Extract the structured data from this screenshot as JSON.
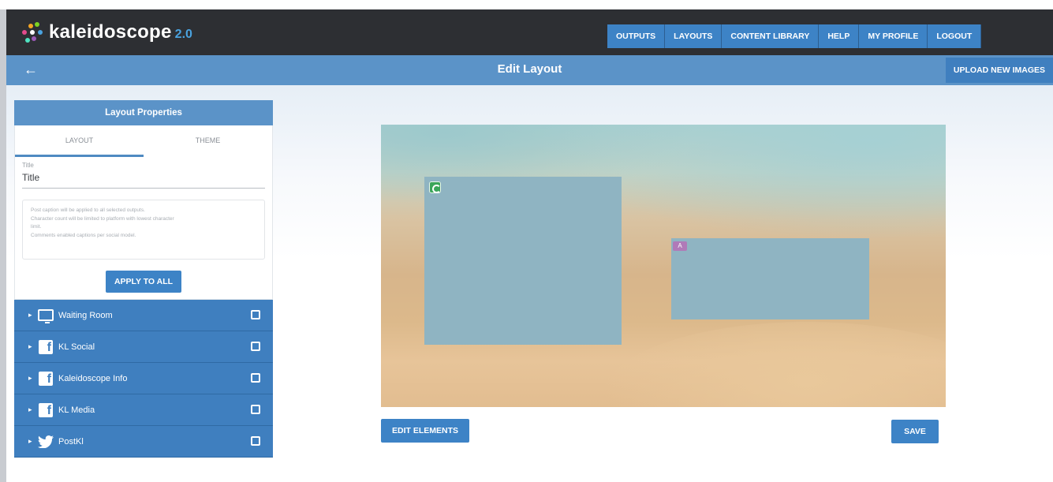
{
  "app": {
    "name": "kaleidoscope",
    "version": "2.0"
  },
  "nav": {
    "items": [
      "OUTPUTS",
      "LAYOUTS",
      "CONTENT LIBRARY",
      "HELP",
      "MY PROFILE",
      "LOGOUT"
    ]
  },
  "titlebar": {
    "back_icon": "back-arrow-icon",
    "title": "Edit Layout",
    "upload_label": "UPLOAD NEW IMAGES"
  },
  "panel": {
    "heading": "Layout Properties",
    "tabs": [
      "LAYOUT",
      "THEME"
    ],
    "active_tab": "LAYOUT",
    "title_field": {
      "label": "Title",
      "value": "Title"
    },
    "notes": [
      "Post caption will be applied to all selected outputs.",
      "Character count will be limited to platform with lowest character",
      "limit.",
      "Comments enabled captions per social model."
    ],
    "apply_label": "APPLY TO ALL",
    "channels": [
      {
        "label": "Waiting Room",
        "icon": "monitor-icon",
        "checked": false
      },
      {
        "label": "KL Social",
        "icon": "facebook-icon",
        "checked": false
      },
      {
        "label": "Kaleidoscope Info",
        "icon": "facebook-icon",
        "checked": false
      },
      {
        "label": "KL Media",
        "icon": "facebook-icon",
        "checked": false
      },
      {
        "label": "PostKl",
        "icon": "twitter-icon",
        "checked": false
      }
    ]
  },
  "canvas": {
    "background": "beach-sand-image",
    "zones": [
      {
        "name": "zone-1",
        "icon": "refresh-icon"
      },
      {
        "name": "zone-2",
        "icon": "text-translate-icon"
      }
    ]
  },
  "actions": {
    "edit_elements_label": "EDIT ELEMENTS",
    "save_label": "SAVE"
  },
  "colors": {
    "header_bg": "#2d2f33",
    "accent": "#3d83c6",
    "titlebar_bg": "#5b93c8",
    "zone_fill": "#8fb4c2",
    "logo_version": "#4aa3e0"
  }
}
